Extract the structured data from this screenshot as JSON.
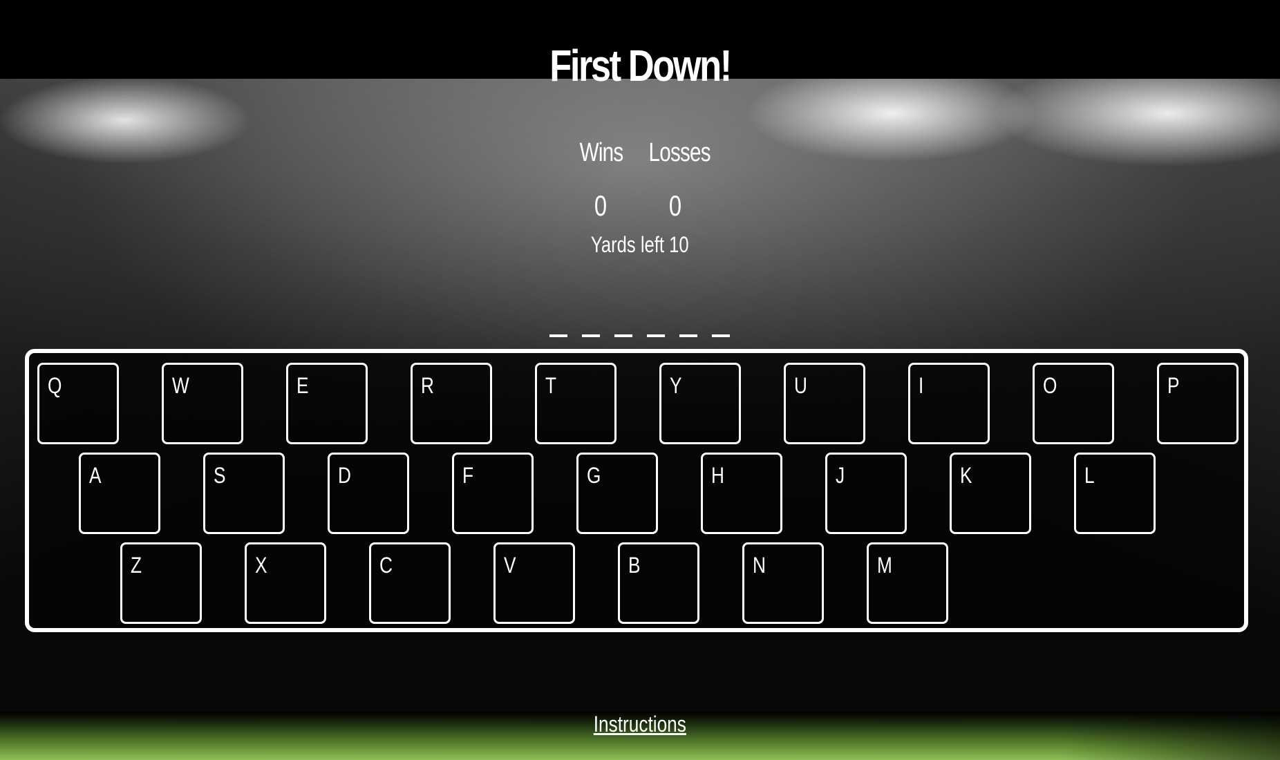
{
  "title": "First Down!",
  "scoreboard": {
    "wins_label": "Wins",
    "losses_label": "Losses",
    "wins": "0",
    "losses": "0"
  },
  "yards_left": "Yards left 10",
  "word_blanks": 6,
  "keyboard": {
    "rows": [
      [
        "Q",
        "W",
        "E",
        "R",
        "T",
        "Y",
        "U",
        "I",
        "O",
        "P"
      ],
      [
        "A",
        "S",
        "D",
        "F",
        "G",
        "H",
        "J",
        "K",
        "L"
      ],
      [
        "Z",
        "X",
        "C",
        "V",
        "B",
        "N",
        "M"
      ]
    ]
  },
  "instructions_link": "Instructions"
}
